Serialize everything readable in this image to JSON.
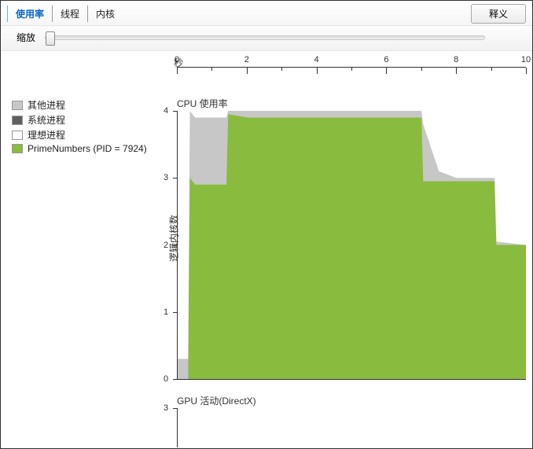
{
  "tabs": {
    "utilization": "使用率",
    "threads": "线程",
    "cores": "内核"
  },
  "help_button": "释义",
  "zoom_label": "缩放",
  "time_axis_label": "秒",
  "legend": {
    "other": {
      "label": "其他进程",
      "color": "#c7c7c7"
    },
    "system": {
      "label": "系统进程",
      "color": "#606060"
    },
    "ideal": {
      "label": "理想进程",
      "color": "#ffffff"
    },
    "process": {
      "label": "PrimeNumbers (PID = 7924)",
      "color": "#89bb3e"
    }
  },
  "cpu_chart": {
    "title": "CPU 使用率",
    "ylabel": "逻辑内核数",
    "ymax": 4
  },
  "gpu_chart": {
    "title": "GPU 活动(DirectX)",
    "ymax": 3
  },
  "chart_data": {
    "type": "area",
    "title": "CPU 使用率",
    "xlabel": "秒",
    "ylabel": "逻辑内核数",
    "ylim": [
      0,
      4
    ],
    "xlim": [
      0,
      10
    ],
    "x_ticks": [
      0,
      2,
      4,
      6,
      8,
      10
    ],
    "y_ticks": [
      0,
      1,
      2,
      3,
      4
    ],
    "series": [
      {
        "name": "PrimeNumbers (PID = 7924)",
        "color": "#89bb3e",
        "x": [
          0.0,
          0.3,
          0.35,
          0.5,
          1.0,
          1.4,
          1.45,
          2.0,
          3.0,
          4.0,
          5.0,
          6.0,
          7.0,
          7.05,
          7.5,
          8.0,
          9.1,
          9.15,
          10.0
        ],
        "values": [
          0.0,
          0.0,
          3.0,
          2.9,
          2.9,
          2.9,
          3.95,
          3.9,
          3.9,
          3.9,
          3.9,
          3.9,
          3.9,
          2.95,
          2.95,
          2.95,
          2.95,
          2.0,
          2.0
        ]
      },
      {
        "name": "其他进程",
        "color": "#c7c7c7",
        "x": [
          0.0,
          0.3,
          0.35,
          0.5,
          1.0,
          1.4,
          1.45,
          2.0,
          3.0,
          4.0,
          5.0,
          6.0,
          7.0,
          7.05,
          7.5,
          8.0,
          9.1,
          9.15,
          10.0
        ],
        "values": [
          0.3,
          0.3,
          4.0,
          3.9,
          3.9,
          3.9,
          4.0,
          4.0,
          4.0,
          4.0,
          4.0,
          4.0,
          4.0,
          3.8,
          3.1,
          3.0,
          3.0,
          2.05,
          2.0
        ]
      }
    ]
  }
}
